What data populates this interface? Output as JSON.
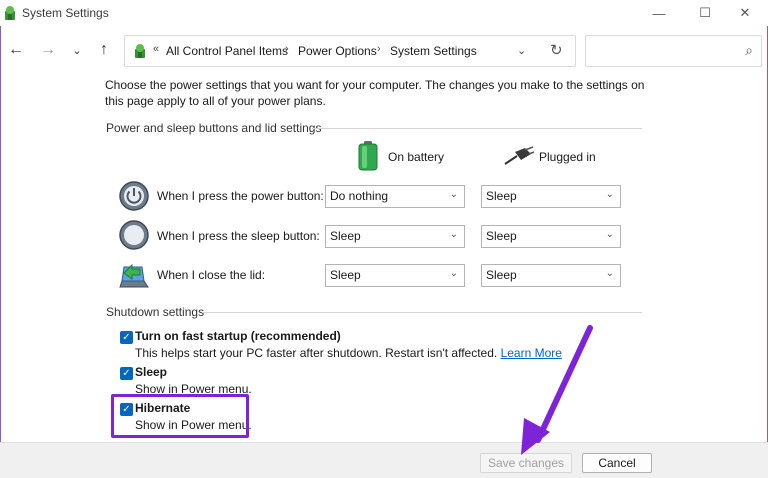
{
  "window": {
    "title": "System Settings",
    "minimize_glyph": "—",
    "maximize_glyph": "☐",
    "close_glyph": "✕"
  },
  "nav": {
    "back_glyph": "←",
    "forward_glyph": "→",
    "recent_glyph": "⌄",
    "up_glyph": "↑",
    "overflow_glyph": "«",
    "separator": "›",
    "breadcrumbs": [
      "All Control Panel Items",
      "Power Options",
      "System Settings"
    ],
    "dropdown_glyph": "⌄",
    "refresh_glyph": "↻",
    "search_placeholder": "",
    "search_glyph": "⌕"
  },
  "intro": "Choose the power settings that you want for your computer. The changes you make to the settings on this page apply to all of your power plans.",
  "buttons_section": {
    "title": "Power and sleep buttons and lid settings",
    "col_battery": "On battery",
    "col_plugged": "Plugged in",
    "rows": [
      {
        "label": "When I press the power button:",
        "battery": "Do nothing",
        "plugged": "Sleep"
      },
      {
        "label": "When I press the sleep button:",
        "battery": "Sleep",
        "plugged": "Sleep"
      },
      {
        "label": "When I close the lid:",
        "battery": "Sleep",
        "plugged": "Sleep"
      }
    ],
    "select_arrow": "⌄"
  },
  "shutdown_section": {
    "title": "Shutdown settings",
    "check_glyph": "✓",
    "items": [
      {
        "label": "Turn on fast startup (recommended)",
        "desc": "This helps start your PC faster after shutdown. Restart isn't affected.",
        "link": "Learn More",
        "checked": true
      },
      {
        "label": "Sleep",
        "desc": "Show in Power menu.",
        "checked": true
      },
      {
        "label": "Hibernate",
        "desc": "Show in Power menu.",
        "checked": true
      }
    ]
  },
  "footer": {
    "save_label": "Save changes",
    "cancel_label": "Cancel"
  },
  "colors": {
    "annotation": "#7d24d9",
    "checkbox": "#0067c0",
    "link": "#0066cc"
  }
}
